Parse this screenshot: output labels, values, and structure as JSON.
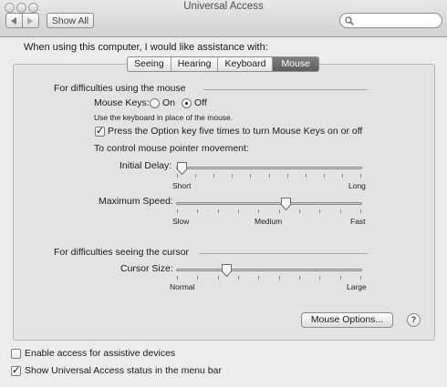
{
  "window": {
    "title": "Universal Access"
  },
  "toolbar": {
    "show_all_label": "Show All",
    "back_icon": "back-arrow-icon",
    "forward_icon": "forward-arrow-icon",
    "search_placeholder": ""
  },
  "intro": "When using this computer, I would like assistance with:",
  "tabs": [
    {
      "label": "Seeing",
      "selected": false
    },
    {
      "label": "Hearing",
      "selected": false
    },
    {
      "label": "Keyboard",
      "selected": false
    },
    {
      "label": "Mouse",
      "selected": true
    }
  ],
  "mouse_section": {
    "title": "For difficulties using the mouse",
    "mouse_keys_label": "Mouse Keys:",
    "on_label": "On",
    "off_label": "Off",
    "selected": "Off",
    "hint": "Use the keyboard in place of the mouse.",
    "option_key_label": "Press the Option key five times to turn Mouse Keys on or off",
    "option_key_checked": true,
    "pointer_label": "To control mouse pointer movement:",
    "initial_delay": {
      "label": "Initial Delay:",
      "min_label": "Short",
      "max_label": "Long",
      "value": 0.03
    },
    "max_speed": {
      "label": "Maximum Speed:",
      "min_label": "Slow",
      "mid_label": "Medium",
      "max_label": "Fast",
      "value": 0.59
    }
  },
  "cursor_section": {
    "title": "For difficulties seeing the cursor",
    "cursor_size": {
      "label": "Cursor Size:",
      "min_label": "Normal",
      "max_label": "Large",
      "value": 0.27
    }
  },
  "mouse_options_label": "Mouse Options...",
  "help_label": "?",
  "footer": {
    "assistive_label": "Enable access for assistive devices",
    "assistive_checked": false,
    "menubar_label": "Show Universal Access status in the menu bar",
    "menubar_checked": true
  }
}
